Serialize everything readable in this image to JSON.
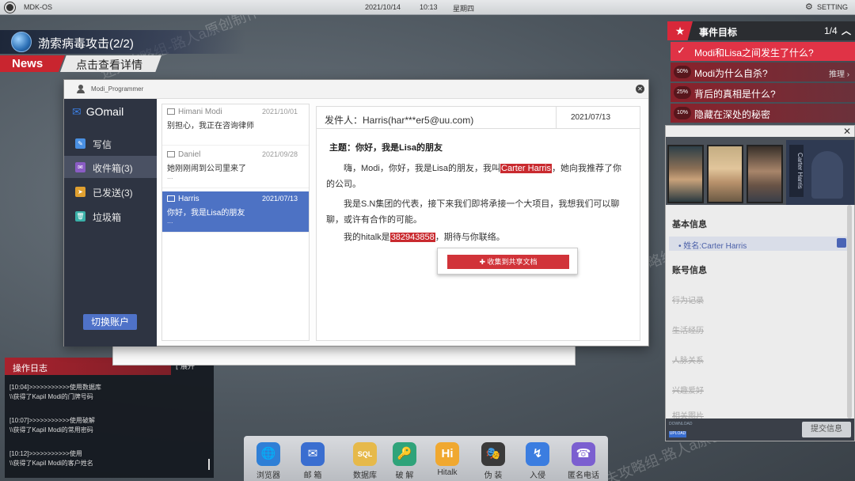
{
  "topbar": {
    "os_name": "MDK-OS",
    "date": "2021/10/14",
    "time": "10:13",
    "weekday": "星期四",
    "setting_label": "SETTING"
  },
  "news": {
    "headline": "渤索病毒攻击(2/2)",
    "tag": "News",
    "link": "点击查看详情"
  },
  "objectives": {
    "title": "事件目标",
    "progress": "1/4",
    "items": [
      {
        "badge": "✓",
        "text": "Modi和Lisa之间发生了什么?",
        "hint": ""
      },
      {
        "badge": "50%",
        "text": "Modi为什么自杀?",
        "hint": "推理"
      },
      {
        "badge": "25%",
        "text": "背后的真相是什么?",
        "hint": ""
      },
      {
        "badge": "10%",
        "text": "隐藏在深处的秘密",
        "hint": ""
      }
    ]
  },
  "profile": {
    "portrait_tag": "Carter Harris",
    "basic_info_label": "基本信息",
    "name_field": "• 姓名:Carter Harris",
    "account_info_label": "账号信息",
    "locked_items": [
      "行为记录",
      "生活经历",
      "人脉关系",
      "兴趣爱好",
      "相关图片"
    ],
    "download_label": "DOWNLOAD",
    "upload_label": "UPLOAD",
    "submit_label": "提交信息"
  },
  "oplog": {
    "title": "操作日志",
    "expand_label": "展开",
    "entries": [
      {
        "line1": "[10:04]>>>>>>>>>>>使用数据库",
        "line2": "\\\\获得了Kapil Modi的门牌号码"
      },
      {
        "line1": "[10:07]>>>>>>>>>>>使用破解",
        "line2": "\\\\获得了Kapil Modi的常用密码"
      },
      {
        "line1": "[10:12]>>>>>>>>>>>使用",
        "line2": "\\\\获得了Kapil Modi的客户姓名"
      }
    ]
  },
  "dock": {
    "items": [
      {
        "label": "浏览器",
        "icon": "🌐",
        "color": "#2f7fd6"
      },
      {
        "label": "邮 箱",
        "icon": "✉",
        "color": "#3a6ed0"
      },
      {
        "label": "数据库",
        "icon": "SQL",
        "color": "#e6b94a"
      },
      {
        "label": "破 解",
        "icon": "🔑",
        "color": "#2fa37a"
      },
      {
        "label": "Hitalk",
        "icon": "Hi",
        "color": "#f0a830"
      },
      {
        "label": "伪 装",
        "icon": "🎭",
        "color": "#3a3a3a"
      },
      {
        "label": "入侵",
        "icon": "↯",
        "color": "#3b7de0"
      },
      {
        "label": "匿名电话",
        "icon": "☎",
        "color": "#7b5fd0"
      }
    ]
  },
  "mail": {
    "account": "Modi_Programmer",
    "brand": "GOmail",
    "nav": [
      {
        "icon": "✎",
        "label": "写信",
        "color": "#4a90e2"
      },
      {
        "icon": "✉",
        "label": "收件箱(3)",
        "color": "#8a5cc4"
      },
      {
        "icon": "➤",
        "label": "已发送(3)",
        "color": "#e0a030"
      },
      {
        "icon": "🗑",
        "label": "垃圾箱",
        "color": "#3ab0a8"
      }
    ],
    "switch_label": "切换账户",
    "messages": [
      {
        "from": "Himani Modi",
        "date": "2021/10/01",
        "snippet": "别担心，我正在咨询律师",
        "ellipsis": ""
      },
      {
        "from": "Daniel",
        "date": "2021/09/28",
        "snippet": "她刚刚闹到公司里来了",
        "ellipsis": "..."
      },
      {
        "from": "Harris",
        "date": "2021/07/13",
        "snippet": "你好，我是Lisa的朋友",
        "ellipsis": "..."
      }
    ],
    "reader": {
      "sender": "发件人：Harris(har***er5@uu.com)",
      "date": "2021/07/13",
      "subject": "主题：你好，我是Lisa的朋友",
      "p1_a": "　　嗨，Modi，你好，我是Lisa的朋友，我叫",
      "p1_hl": "Carter Harris",
      "p1_b": "，她向我推荐了你",
      "p1_c": "的公司。",
      "p2_a": "　　我是S.N集团的代表，接下来我们即将承接一个大项目，我想我们可以聊",
      "p2_b": "聊，或许有合作的可能。",
      "p3_a": "　　我的hitalk是",
      "p3_hl": "382943858",
      "p3_b": "，期待与你联络。",
      "context_action": "✚  收集到共享文档"
    }
  },
  "watermark": "迷失攻略组-路人a原创制作"
}
